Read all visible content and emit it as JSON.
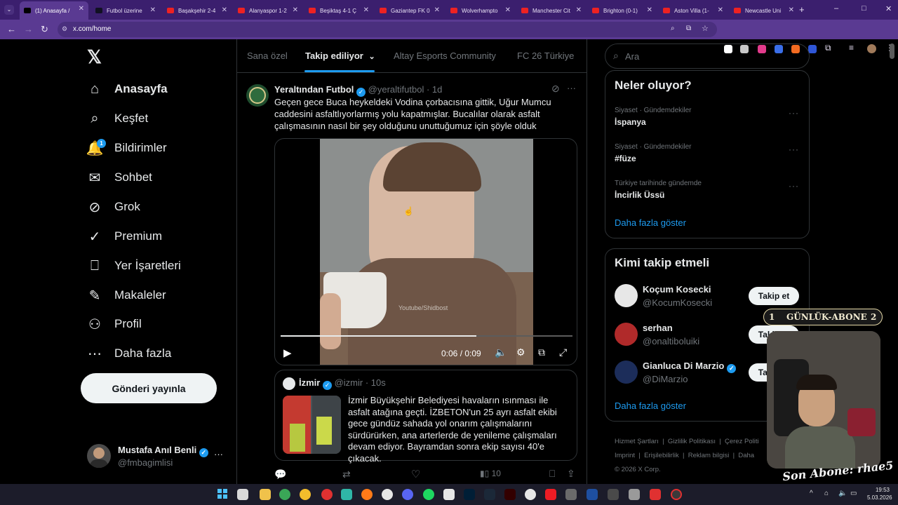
{
  "browser": {
    "tabs": [
      {
        "label": "(1) Anasayfa /",
        "fav": "x",
        "active": true
      },
      {
        "label": "Futbol üzerine",
        "fav": "site"
      },
      {
        "label": "Başakşehir 2-4",
        "fav": "yt"
      },
      {
        "label": "Alanyaspor 1-2",
        "fav": "yt"
      },
      {
        "label": "Beşiktaş 4-1 Ç",
        "fav": "yt"
      },
      {
        "label": "Gaziantep FK 0",
        "fav": "yt"
      },
      {
        "label": "Wolverhampto",
        "fav": "yt"
      },
      {
        "label": "Manchester Cit",
        "fav": "yt"
      },
      {
        "label": "Brighton (0-1)",
        "fav": "yt"
      },
      {
        "label": "Aston Villa (1-",
        "fav": "yt"
      },
      {
        "label": "Newcastle Uni",
        "fav": "yt"
      }
    ],
    "new_tab": "+",
    "url": "x.com/home",
    "window_controls": [
      "–",
      "□",
      "✕"
    ]
  },
  "sidebar": {
    "logo": "𝕏",
    "items": [
      {
        "label": "Anasayfa",
        "icon": "home-icon",
        "glyph": "⌂"
      },
      {
        "label": "Keşfet",
        "icon": "search-icon",
        "glyph": "⌕"
      },
      {
        "label": "Bildirimler",
        "icon": "bell-icon",
        "glyph": "🔔",
        "badge": "1"
      },
      {
        "label": "Sohbet",
        "icon": "mail-icon",
        "glyph": "✉"
      },
      {
        "label": "Grok",
        "icon": "grok-icon",
        "glyph": "⊘"
      },
      {
        "label": "Premium",
        "icon": "premium-icon",
        "glyph": "✓"
      },
      {
        "label": "Yer İşaretleri",
        "icon": "bookmark-icon",
        "glyph": "⎕"
      },
      {
        "label": "Makaleler",
        "icon": "article-icon",
        "glyph": "✎"
      },
      {
        "label": "Profil",
        "icon": "profile-icon",
        "glyph": "⚇"
      },
      {
        "label": "Daha fazla",
        "icon": "more-icon",
        "glyph": "⋯"
      }
    ],
    "post_button": "Gönderi yayınla",
    "account": {
      "name": "Mustafa Anıl Benli",
      "handle": "@fmbagimlisi",
      "more": "···"
    }
  },
  "timeline": {
    "tabs": [
      "Sana özel",
      "Takip ediliyor",
      "Altay Esports Community",
      "FC 26 Türkiye"
    ],
    "active_tab": "Takip ediliyor",
    "tweet": {
      "author": "Yeraltından Futbol",
      "handle": "@yeraltifutbol",
      "time": "· 1d",
      "text": "Geçen gece Buca heykeldeki Vodina çorbacısına gittik, Uğur Mumcu caddesini asfaltlıyorlarmış yolu kapatmışlar. Bucalılar olarak asfalt çalışmasının nasıl bir şey olduğunu unuttuğumuz için şöyle olduk",
      "video": {
        "watermark": "Youtube/Shidbost",
        "time": "0:06 / 0:09",
        "progress": 0.67
      },
      "quote": {
        "author": "İzmir",
        "handle": "@izmir",
        "time": "· 10s",
        "text": "İzmir Büyükşehir Belediyesi havaların ısınması ile asfalt atağına geçti.  İZBETON'un 25 ayrı asfalt ekibi gece gündüz sahada yol onarım çalışmalarını sürdürürken, ana arterlerde de yenileme çalışmaları devam ediyor. Bayramdan sonra ekip sayısı 40'e çıkacak."
      },
      "views": "10"
    }
  },
  "right": {
    "search_placeholder": "Ara",
    "trends_title": "Neler oluyor?",
    "trends": [
      {
        "meta": "Siyaset · Gündemdekiler",
        "name": "İspanya"
      },
      {
        "meta": "Siyaset · Gündemdekiler",
        "name": "#füze"
      },
      {
        "meta": "Türkiye tarihinde gündemde",
        "name": "İncirlik Üssü"
      }
    ],
    "show_more": "Daha fazla göster",
    "who_title": "Kimi takip etmeli",
    "who": [
      {
        "name": "Koçum Kosecki",
        "handle": "@KocumKosecki",
        "button": "Takip et"
      },
      {
        "name": "serhan",
        "handle": "@onaltiboluiki",
        "button": "Takip et"
      },
      {
        "name": "Gianluca Di Marzio",
        "handle": "@DiMarzio",
        "button": "Takip et",
        "verified": true
      }
    ],
    "who_more": "Daha fazla göster",
    "footer": [
      "Hizmet Şartları",
      "Gizlilik Politikası",
      "Çerez Politi",
      "Imprint",
      "Erişilebilirlik",
      "Reklam bilgisi",
      "Daha",
      "© 2026 X Corp."
    ]
  },
  "overlay": {
    "sub_left": "1",
    "sub_label": "GÜNLÜK-ABONE",
    "sub_right": "2",
    "signature": "Son Abone: rhae5"
  },
  "taskbar": {
    "time": "19:53",
    "date": "5.03.2026"
  }
}
